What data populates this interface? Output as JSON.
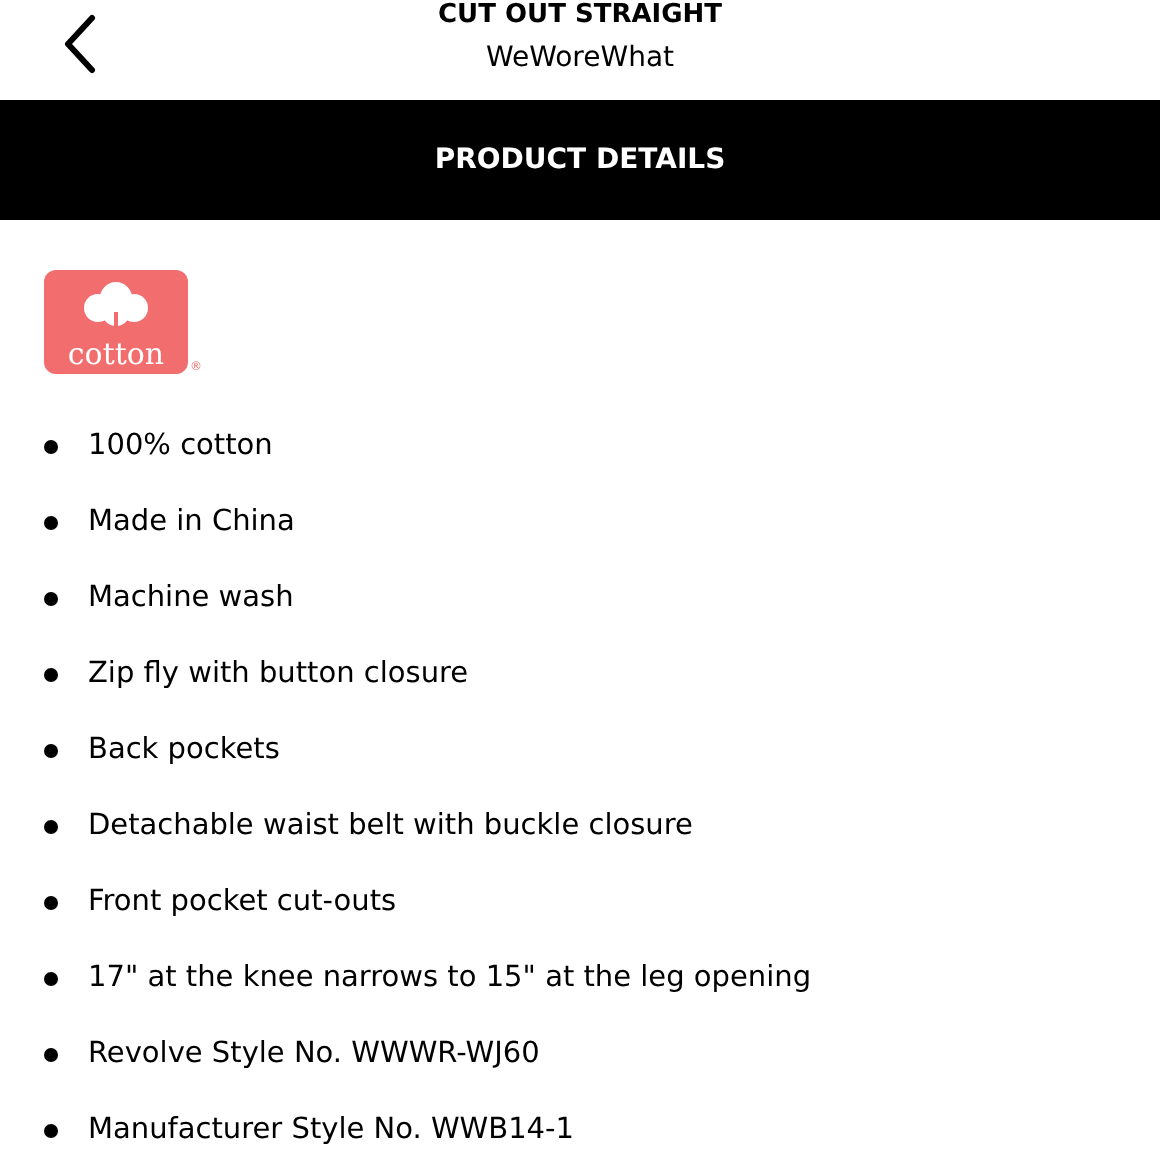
{
  "header": {
    "title": "CUT OUT STRAIGHT",
    "subtitle": "WeWoreWhat"
  },
  "section_bar": {
    "title": "PRODUCT DETAILS"
  },
  "logo": {
    "text": "cotton",
    "mark": "®"
  },
  "details": [
    "100% cotton",
    "Made in China",
    "Machine wash",
    "Zip fly with button closure",
    "Back pockets",
    "Detachable waist belt with buckle closure",
    "Front pocket cut-outs",
    "17\" at the knee narrows to 15\" at the leg opening",
    "Revolve Style No. WWWR-WJ60",
    "Manufacturer Style No. WWB14-1"
  ]
}
